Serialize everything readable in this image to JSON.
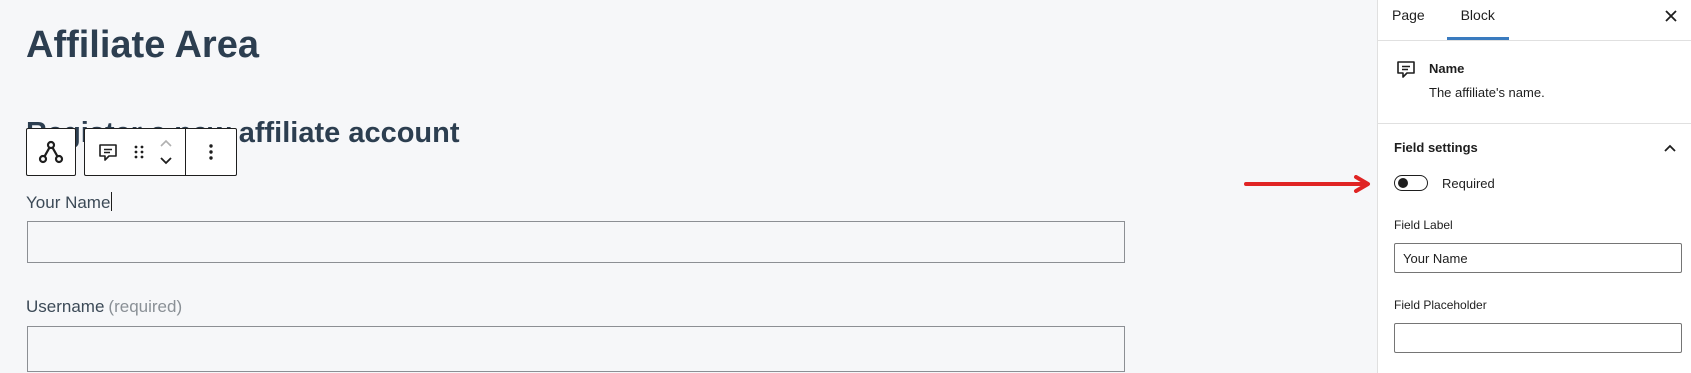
{
  "editor": {
    "page_title": "Affiliate Area",
    "section_heading": "Register a new affiliate account",
    "fields": [
      {
        "label": "Your Name",
        "value": ""
      },
      {
        "label": "Username",
        "suffix": "(required)",
        "value": ""
      }
    ],
    "toolbar": {
      "parent_icon": "affiliatewp-logo-icon",
      "block_icon": "comment-form-icon",
      "drag_icon": "drag-handle-icon",
      "move_up_icon": "chevron-up-icon",
      "move_down_icon": "chevron-down-icon",
      "options_icon": "more-vertical-icon"
    }
  },
  "annotation": {
    "arrow_color": "#e02424"
  },
  "sidebar": {
    "tabs": [
      "Page",
      "Block"
    ],
    "active_tab": "Block",
    "close_icon": "close-icon",
    "block_card": {
      "icon": "comment-form-icon",
      "title": "Name",
      "description": "The affiliate's name."
    },
    "field_settings": {
      "title": "Field settings",
      "required_label": "Required",
      "required_on": false,
      "field_label_title": "Field Label",
      "field_label_value": "Your Name",
      "placeholder_title": "Field Placeholder",
      "placeholder_value": ""
    }
  },
  "colors": {
    "accent": "#3a7bbf",
    "heading": "#2c3e50",
    "arrow": "#e02424"
  }
}
